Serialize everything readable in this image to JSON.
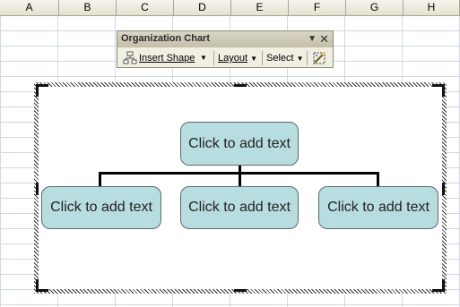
{
  "columns": [
    "A",
    "B",
    "C",
    "D",
    "E",
    "F",
    "G",
    "H"
  ],
  "toolbar": {
    "title": "Organization Chart",
    "insert_shape_label": "Insert Shape",
    "layout_label": "Layout",
    "select_label": "Select",
    "dropdown_glyph": "▼",
    "close_glyph": "✕"
  },
  "org_chart": {
    "top_box": "Click to add text",
    "left_box": "Click to add text",
    "middle_box": "Click to add text",
    "right_box": "Click to add text"
  },
  "colors": {
    "box_fill": "#b8dde1",
    "toolbar_bg": "#f1efe2",
    "header_bg": "#ece9d8"
  },
  "icons": {
    "insert_shape": "org-shape-icon",
    "autoformat": "autoformat-icon"
  }
}
